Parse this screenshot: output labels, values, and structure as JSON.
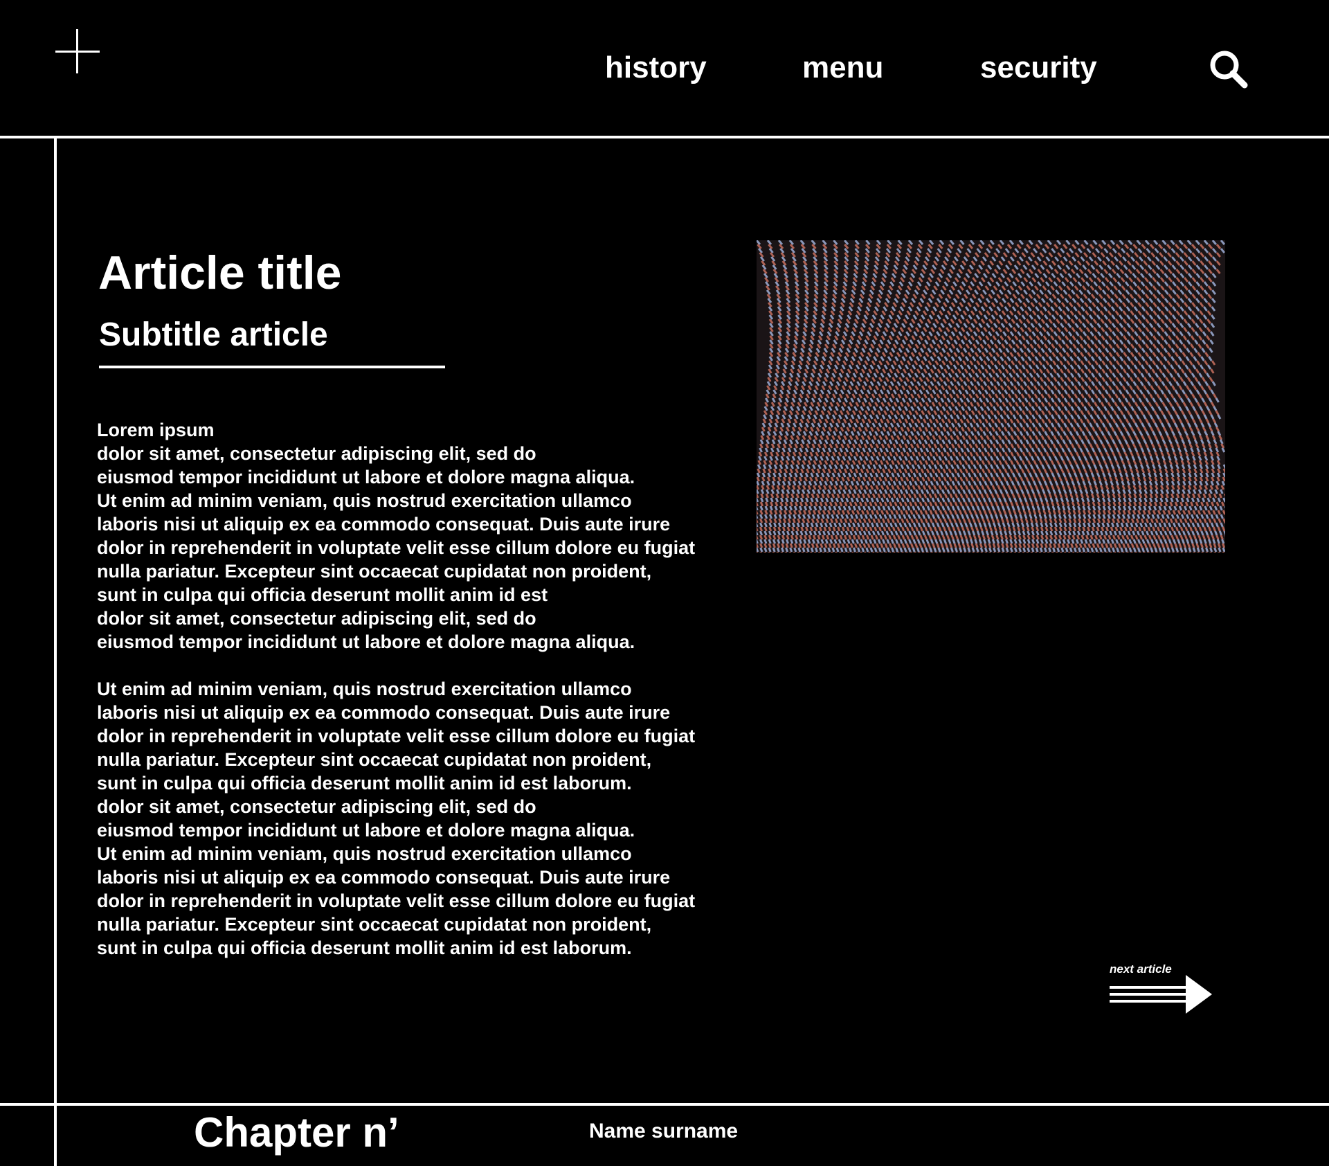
{
  "header": {
    "plus_icon": "plus-icon",
    "nav": [
      {
        "label": "history"
      },
      {
        "label": "menu"
      },
      {
        "label": "security"
      }
    ],
    "search_icon": "search-icon"
  },
  "article": {
    "title": "Article title",
    "subtitle": "Subtitle article",
    "paragraphs": [
      "Lorem ipsum\ndolor sit amet, consectetur adipiscing elit, sed do\neiusmod tempor incididunt ut labore et dolore magna aliqua.\nUt enim ad minim veniam, quis nostrud exercitation ullamco\nlaboris nisi ut aliquip ex ea commodo consequat. Duis aute irure\ndolor in reprehenderit in voluptate velit esse cillum dolore eu fugiat\nnulla pariatur. Excepteur sint occaecat cupidatat non proident,\nsunt in culpa qui officia deserunt mollit anim id est\ndolor sit amet, consectetur adipiscing elit, sed do\neiusmod tempor incididunt ut labore et dolore magna aliqua.",
      "Ut enim ad minim veniam, quis nostrud exercitation ullamco\nlaboris nisi ut aliquip ex ea commodo consequat. Duis aute irure\ndolor in reprehenderit in voluptate velit esse cillum dolore eu fugiat\nnulla pariatur. Excepteur sint occaecat cupidatat non proident,\nsunt in culpa qui officia deserunt mollit anim id est laborum.\ndolor sit amet, consectetur adipiscing elit, sed do\neiusmod tempor incididunt ut labore et dolore magna aliqua.\nUt enim ad minim veniam, quis nostrud exercitation ullamco\nlaboris nisi ut aliquip ex ea commodo consequat. Duis aute irure\ndolor in reprehenderit in voluptate velit esse cillum dolore eu fugiat\nnulla pariatur. Excepteur sint occaecat cupidatat non proident,\nsunt in culpa qui officia deserunt mollit anim id est laborum."
    ],
    "image_icon": "glitch-image"
  },
  "next_article": {
    "label": "next article",
    "icon": "arrow-right-icon"
  },
  "footer": {
    "chapter": "Chapter n’",
    "author": "Name surname"
  },
  "colors": {
    "background": "#000000",
    "foreground": "#ffffff",
    "image_blue": "#9fb0d8",
    "image_red": "#c8705f"
  }
}
